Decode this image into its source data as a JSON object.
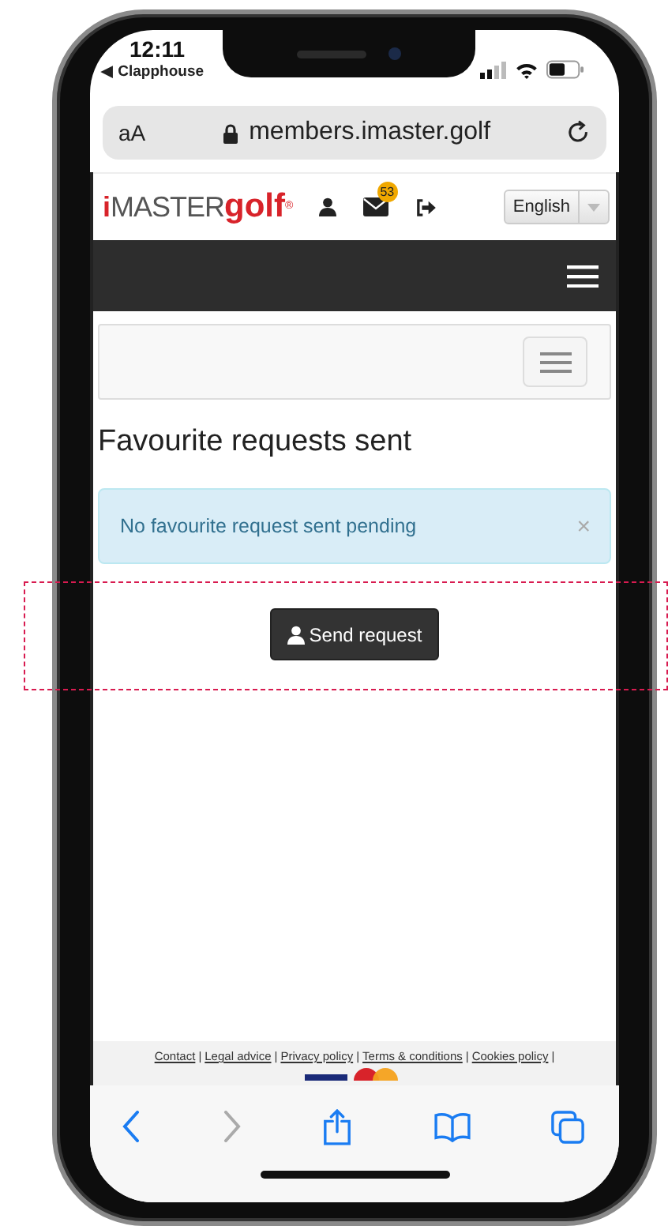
{
  "status_bar": {
    "time": "12:11",
    "back_app": "◀ Clapphouse"
  },
  "address_bar": {
    "text_size": "aA",
    "url": "members.imaster.golf"
  },
  "site_header": {
    "logo": [
      {
        "text": "i",
        "kind": "accent"
      },
      {
        "text": "MASTER",
        "kind": "plain"
      },
      {
        "text": "golf",
        "kind": "bold"
      },
      {
        "text": "®",
        "kind": "mark"
      }
    ],
    "mail_badge": "53",
    "language": "English"
  },
  "page": {
    "title": "Favourite requests sent",
    "alert": {
      "message": "No favourite request sent pending",
      "close": "×"
    },
    "button": "Send request"
  },
  "footer_links": [
    {
      "label": "Contact",
      "separator": "|"
    },
    {
      "label": "Legal advice",
      "separator": "|"
    },
    {
      "label": "Privacy policy",
      "separator": "|"
    },
    {
      "label": "Terms & conditions",
      "separator": "|"
    },
    {
      "label": "Cookies policy",
      "separator": "|"
    }
  ],
  "browser_toolbar": {
    "back_enabled": true,
    "forward_enabled": false
  }
}
